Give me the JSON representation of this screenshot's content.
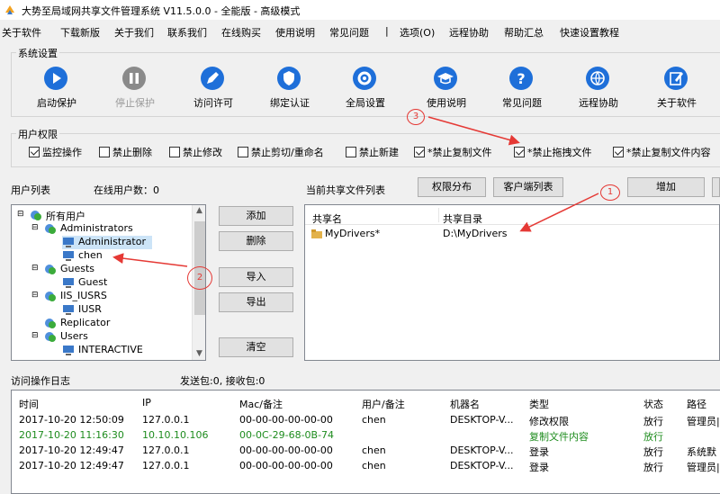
{
  "window": {
    "title": "大势至局域网共享文件管理系统 V11.5.0.0 - 全能版 - 高级模式"
  },
  "menu": [
    "关于软件",
    "下载新版",
    "关于我们",
    "联系我们",
    "在线购买",
    "使用说明",
    "常见问题",
    "|",
    "选项(O)",
    "远程协助",
    "帮助汇总",
    "快速设置教程"
  ],
  "settings_group": {
    "label": "系统设置"
  },
  "toolbar": [
    {
      "label": "启动保护",
      "icon": "play-icon",
      "enabled": true
    },
    {
      "label": "停止保护",
      "icon": "pause-icon",
      "enabled": false
    },
    {
      "label": "访问许可",
      "icon": "pen-icon",
      "enabled": true
    },
    {
      "label": "绑定认证",
      "icon": "shield-icon",
      "enabled": true
    },
    {
      "label": "全局设置",
      "icon": "gear-icon",
      "enabled": true
    },
    {
      "label": "使用说明",
      "icon": "graduation-cap-icon",
      "enabled": true
    },
    {
      "label": "常见问题",
      "icon": "question-icon",
      "enabled": true
    },
    {
      "label": "远程协助",
      "icon": "globe-icon",
      "enabled": true
    },
    {
      "label": "关于软件",
      "icon": "edit-icon",
      "enabled": true
    }
  ],
  "permissions": {
    "label": "用户权限",
    "items": [
      {
        "label": "监控操作",
        "checked": true
      },
      {
        "label": "禁止删除",
        "checked": false
      },
      {
        "label": "禁止修改",
        "checked": false
      },
      {
        "label": "禁止剪切/重命名",
        "checked": false
      },
      {
        "label": "禁止新建",
        "checked": false
      },
      {
        "label": "*禁止复制文件",
        "checked": true
      },
      {
        "label": "*禁止拖拽文件",
        "checked": true
      },
      {
        "label": "*禁止复制文件内容",
        "checked": true
      }
    ]
  },
  "users": {
    "list_label": "用户列表",
    "online_label": "在线用户数：0",
    "tree": [
      {
        "label": "所有用户",
        "level": 0,
        "type": "group"
      },
      {
        "label": "Administrators",
        "level": 1,
        "type": "group"
      },
      {
        "label": "Administrator",
        "level": 2,
        "type": "user",
        "selected": true
      },
      {
        "label": "chen",
        "level": 2,
        "type": "user"
      },
      {
        "label": "Guests",
        "level": 1,
        "type": "group"
      },
      {
        "label": "Guest",
        "level": 2,
        "type": "user"
      },
      {
        "label": "IIS_IUSRS",
        "level": 1,
        "type": "group"
      },
      {
        "label": "IUSR",
        "level": 2,
        "type": "user"
      },
      {
        "label": "Replicator",
        "level": 1,
        "type": "group"
      },
      {
        "label": "Users",
        "level": 1,
        "type": "group"
      },
      {
        "label": "INTERACTIVE",
        "level": 2,
        "type": "user"
      }
    ],
    "buttons": [
      "添加",
      "删除",
      "导入",
      "导出",
      "清空"
    ]
  },
  "shares": {
    "label": "当前共享文件列表",
    "buttons": {
      "perm_dist": "权限分布",
      "client_list": "客户端列表",
      "add": "增加"
    },
    "columns": [
      "共享名",
      "共享目录"
    ],
    "rows": [
      {
        "name": "MyDrivers*",
        "dir": "D:\\MyDrivers"
      }
    ]
  },
  "log": {
    "label": "访问操作日志",
    "packets": "发送包:0, 接收包:0",
    "columns": [
      "时间",
      "IP",
      "Mac/备注",
      "用户/备注",
      "机器名",
      "类型",
      "状态",
      "路径"
    ],
    "rows": [
      {
        "time": "2017-10-20 12:50:09",
        "ip": "127.0.0.1",
        "mac": "00-00-00-00-00-00",
        "user": "chen",
        "machine": "DESKTOP-V...",
        "type": "修改权限",
        "status": "放行",
        "path": "管理员|",
        "color": "#000000"
      },
      {
        "time": "2017-10-20 11:16:30",
        "ip": "10.10.10.106",
        "mac": "00-0C-29-68-0B-74",
        "user": "",
        "machine": "",
        "type": "复制文件内容",
        "status": "放行",
        "path": "",
        "color": "#1e8c1e"
      },
      {
        "time": "2017-10-20 12:49:47",
        "ip": "127.0.0.1",
        "mac": "00-00-00-00-00-00",
        "user": "chen",
        "machine": "DESKTOP-V...",
        "type": "登录",
        "status": "放行",
        "path": "系统默",
        "color": "#000000"
      },
      {
        "time": "2017-10-20 12:49:47",
        "ip": "127.0.0.1",
        "mac": "00-00-00-00-00-00",
        "user": "chen",
        "machine": "DESKTOP-V...",
        "type": "登录",
        "status": "放行",
        "path": "管理员|",
        "color": "#000000"
      }
    ]
  },
  "annotations": {
    "one": "1",
    "two": "2",
    "three": "3",
    "color": "#e53935"
  },
  "colors": {
    "accent_blue": "#1e6fd9",
    "disabled_gray": "#9a9a9a",
    "selected_bg": "#cce4f7"
  }
}
